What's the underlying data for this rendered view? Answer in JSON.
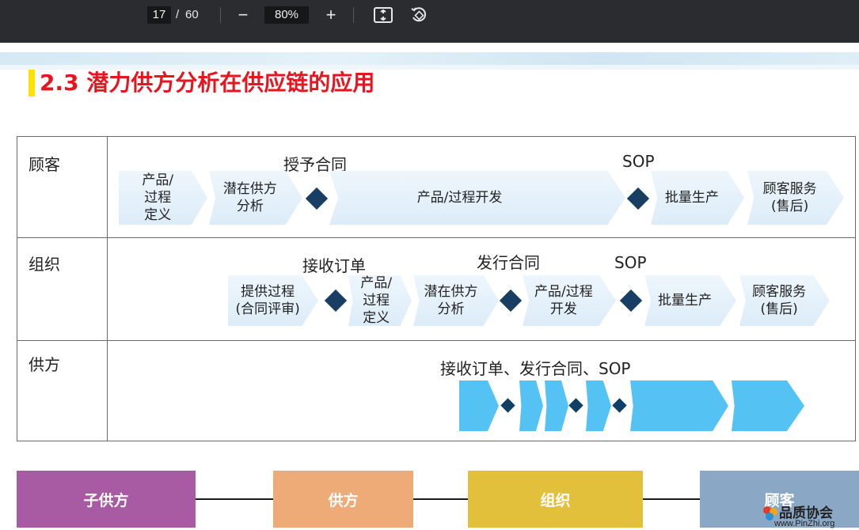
{
  "toolbar": {
    "current_page": "17",
    "page_separator": "/",
    "total_pages": "60",
    "zoom": "80%",
    "zoom_out_glyph": "−",
    "zoom_in_glyph": "+",
    "icons": [
      "zoom-out-icon",
      "zoom-in-icon",
      "fit-page-icon",
      "rotate-icon"
    ]
  },
  "slide": {
    "title": "2.3 潜力供方分析在供应链的应用",
    "colors": {
      "title": "#e8141e",
      "title_marker": "#ffe100",
      "chevron_fill": "#dcecf8",
      "diamond": "#183e63",
      "supplier_arrow": "#55c2f4"
    },
    "rows": [
      {
        "label": "顾客",
        "milestones": [
          "授予合同",
          "SOP"
        ],
        "steps": [
          "产品/\n过程\n定义",
          "潜在供方\n分析",
          "产品/过程开发",
          "批量生产",
          "顾客服务\n(售后)"
        ]
      },
      {
        "label": "组织",
        "milestones": [
          "接收订单",
          "发行合同",
          "SOP"
        ],
        "steps": [
          "提供过程\n(合同评审)",
          "产品/\n过程\n定义",
          "潜在供方\n分析",
          "产品/过程\n开发",
          "批量生产",
          "顾客服务\n(售后)"
        ]
      },
      {
        "label": "供方",
        "milestones": [
          "接收订单、发行合同、SOP"
        ],
        "steps": []
      }
    ],
    "chain": {
      "blocks": [
        {
          "label": "子供方",
          "color": "#a85aa3"
        },
        {
          "label": "供方",
          "color": "#eeaa77"
        },
        {
          "label": "组织",
          "color": "#e2c03c"
        },
        {
          "label": "顾客",
          "color": "#8aa7c6"
        }
      ]
    },
    "logo": {
      "name": "品质协会",
      "url": "www.PinZhi.org"
    }
  }
}
